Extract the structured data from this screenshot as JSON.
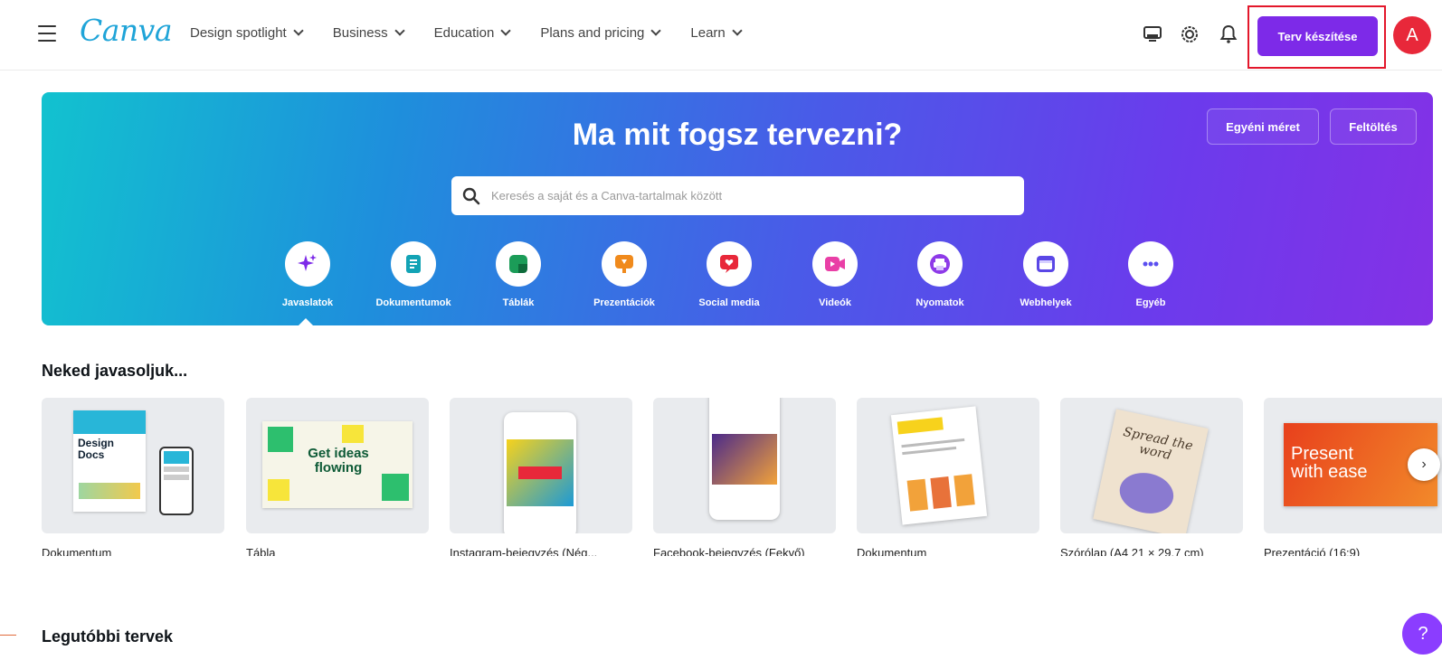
{
  "header": {
    "logo": "Canva",
    "nav": [
      "Design spotlight",
      "Business",
      "Education",
      "Plans and pricing",
      "Learn"
    ],
    "create_button": "Terv készítése",
    "avatar_initial": "A"
  },
  "hero": {
    "title": "Ma mit fogsz tervezni?",
    "custom_size_button": "Egyéni méret",
    "upload_button": "Feltöltés",
    "search_placeholder": "Keresés a saját és a Canva-tartalmak között",
    "categories": [
      {
        "label": "Javaslatok",
        "icon": "sparkle-icon",
        "color": "#7d2ae8"
      },
      {
        "label": "Dokumentumok",
        "icon": "document-icon",
        "color": "#13a3b5"
      },
      {
        "label": "Táblák",
        "icon": "whiteboard-icon",
        "color": "#1b9c58"
      },
      {
        "label": "Prezentációk",
        "icon": "presentation-icon",
        "color": "#f08a1c"
      },
      {
        "label": "Social media",
        "icon": "heart-icon",
        "color": "#e8283a"
      },
      {
        "label": "Videók",
        "icon": "video-icon",
        "color": "#e93fa6"
      },
      {
        "label": "Nyomatok",
        "icon": "printer-icon",
        "color": "#8e3ae8"
      },
      {
        "label": "Webhelyek",
        "icon": "website-icon",
        "color": "#5a47e6"
      },
      {
        "label": "Egyéb",
        "icon": "more-icon",
        "color": "#5b4ff0"
      }
    ]
  },
  "recommended": {
    "title": "Neked javasoljuk...",
    "items": [
      {
        "label": "Dokumentum",
        "thumb_text": "Design Docs"
      },
      {
        "label": "Tábla",
        "thumb_text": "Get ideas flowing"
      },
      {
        "label": "Instagram-bejegyzés (Nég..."
      },
      {
        "label": "Facebook-bejegyzés (Fekvő)"
      },
      {
        "label": "Dokumentum"
      },
      {
        "label": "Szórólap (A4 21 × 29,7 cm)",
        "thumb_text": "Spread the word"
      },
      {
        "label": "Prezentáció (16:9)",
        "thumb_text": "Present with ease"
      }
    ]
  },
  "recent": {
    "title": "Legutóbbi tervek"
  },
  "help_label": "?"
}
